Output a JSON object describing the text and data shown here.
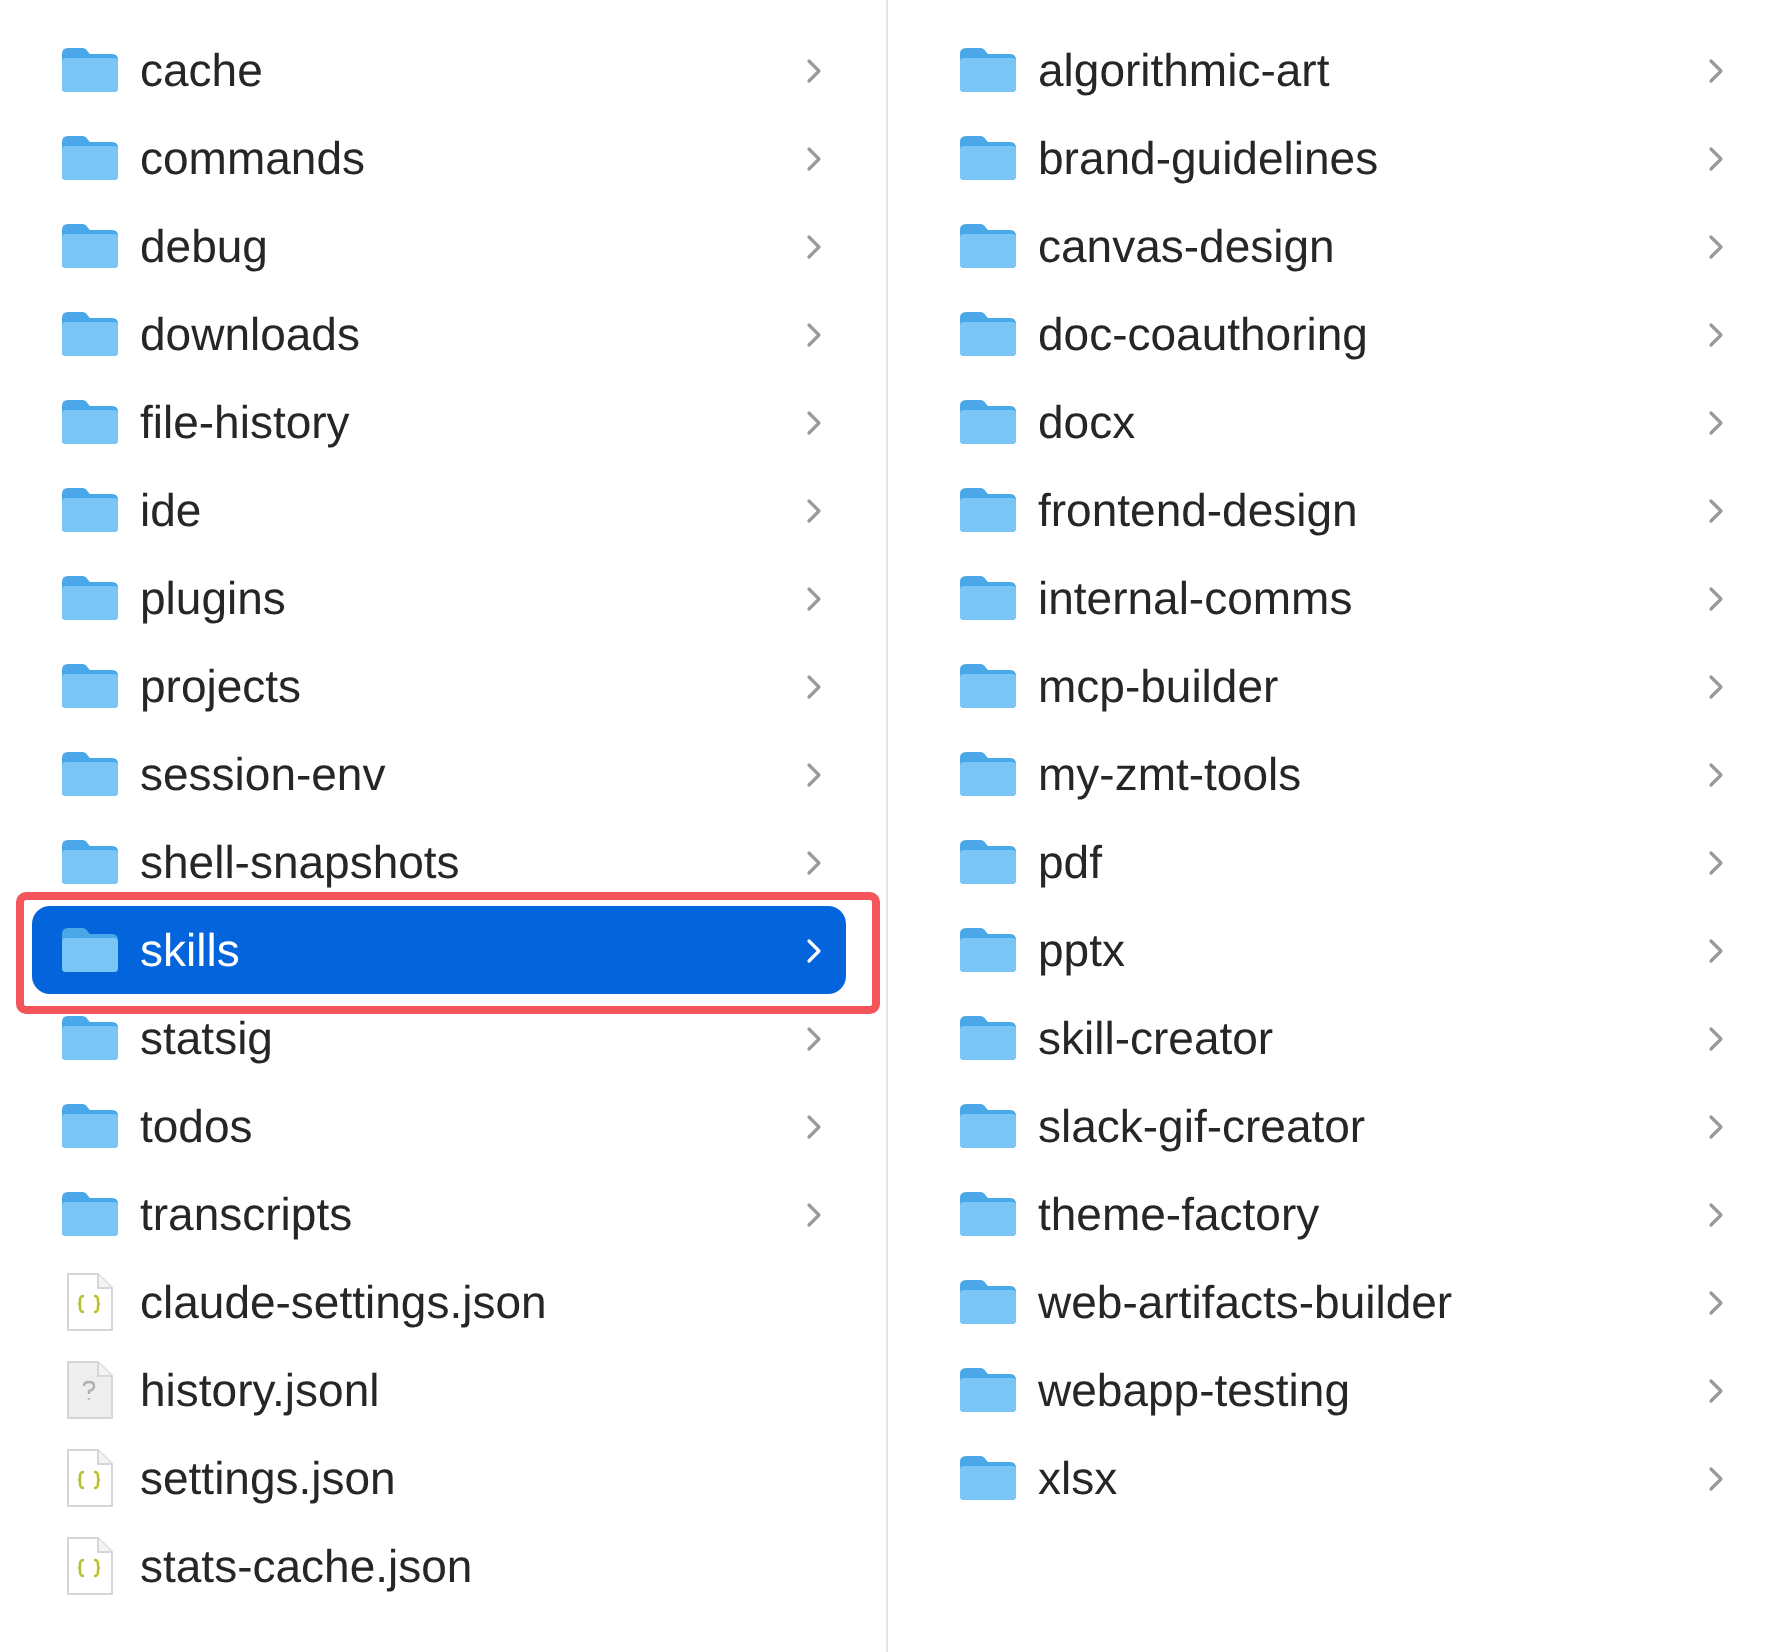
{
  "columns": [
    {
      "items": [
        {
          "name": "cache",
          "kind": "folder",
          "selected": false
        },
        {
          "name": "commands",
          "kind": "folder",
          "selected": false
        },
        {
          "name": "debug",
          "kind": "folder",
          "selected": false
        },
        {
          "name": "downloads",
          "kind": "folder",
          "selected": false
        },
        {
          "name": "file-history",
          "kind": "folder",
          "selected": false
        },
        {
          "name": "ide",
          "kind": "folder",
          "selected": false
        },
        {
          "name": "plugins",
          "kind": "folder",
          "selected": false
        },
        {
          "name": "projects",
          "kind": "folder",
          "selected": false
        },
        {
          "name": "session-env",
          "kind": "folder",
          "selected": false
        },
        {
          "name": "shell-snapshots",
          "kind": "folder",
          "selected": false
        },
        {
          "name": "skills",
          "kind": "folder",
          "selected": true
        },
        {
          "name": "statsig",
          "kind": "folder",
          "selected": false
        },
        {
          "name": "todos",
          "kind": "folder",
          "selected": false
        },
        {
          "name": "transcripts",
          "kind": "folder",
          "selected": false
        },
        {
          "name": "claude-settings.json",
          "kind": "json",
          "selected": false
        },
        {
          "name": "history.jsonl",
          "kind": "unknown",
          "selected": false
        },
        {
          "name": "settings.json",
          "kind": "json",
          "selected": false
        },
        {
          "name": "stats-cache.json",
          "kind": "json",
          "selected": false
        }
      ]
    },
    {
      "items": [
        {
          "name": "algorithmic-art",
          "kind": "folder",
          "selected": false
        },
        {
          "name": "brand-guidelines",
          "kind": "folder",
          "selected": false
        },
        {
          "name": "canvas-design",
          "kind": "folder",
          "selected": false
        },
        {
          "name": "doc-coauthoring",
          "kind": "folder",
          "selected": false
        },
        {
          "name": "docx",
          "kind": "folder",
          "selected": false
        },
        {
          "name": "frontend-design",
          "kind": "folder",
          "selected": false
        },
        {
          "name": "internal-comms",
          "kind": "folder",
          "selected": false
        },
        {
          "name": "mcp-builder",
          "kind": "folder",
          "selected": false
        },
        {
          "name": "my-zmt-tools",
          "kind": "folder",
          "selected": false
        },
        {
          "name": "pdf",
          "kind": "folder",
          "selected": false
        },
        {
          "name": "pptx",
          "kind": "folder",
          "selected": false
        },
        {
          "name": "skill-creator",
          "kind": "folder",
          "selected": false
        },
        {
          "name": "slack-gif-creator",
          "kind": "folder",
          "selected": false
        },
        {
          "name": "theme-factory",
          "kind": "folder",
          "selected": false
        },
        {
          "name": "web-artifacts-builder",
          "kind": "folder",
          "selected": false
        },
        {
          "name": "webapp-testing",
          "kind": "folder",
          "selected": false
        },
        {
          "name": "xlsx",
          "kind": "folder",
          "selected": false
        }
      ]
    }
  ]
}
